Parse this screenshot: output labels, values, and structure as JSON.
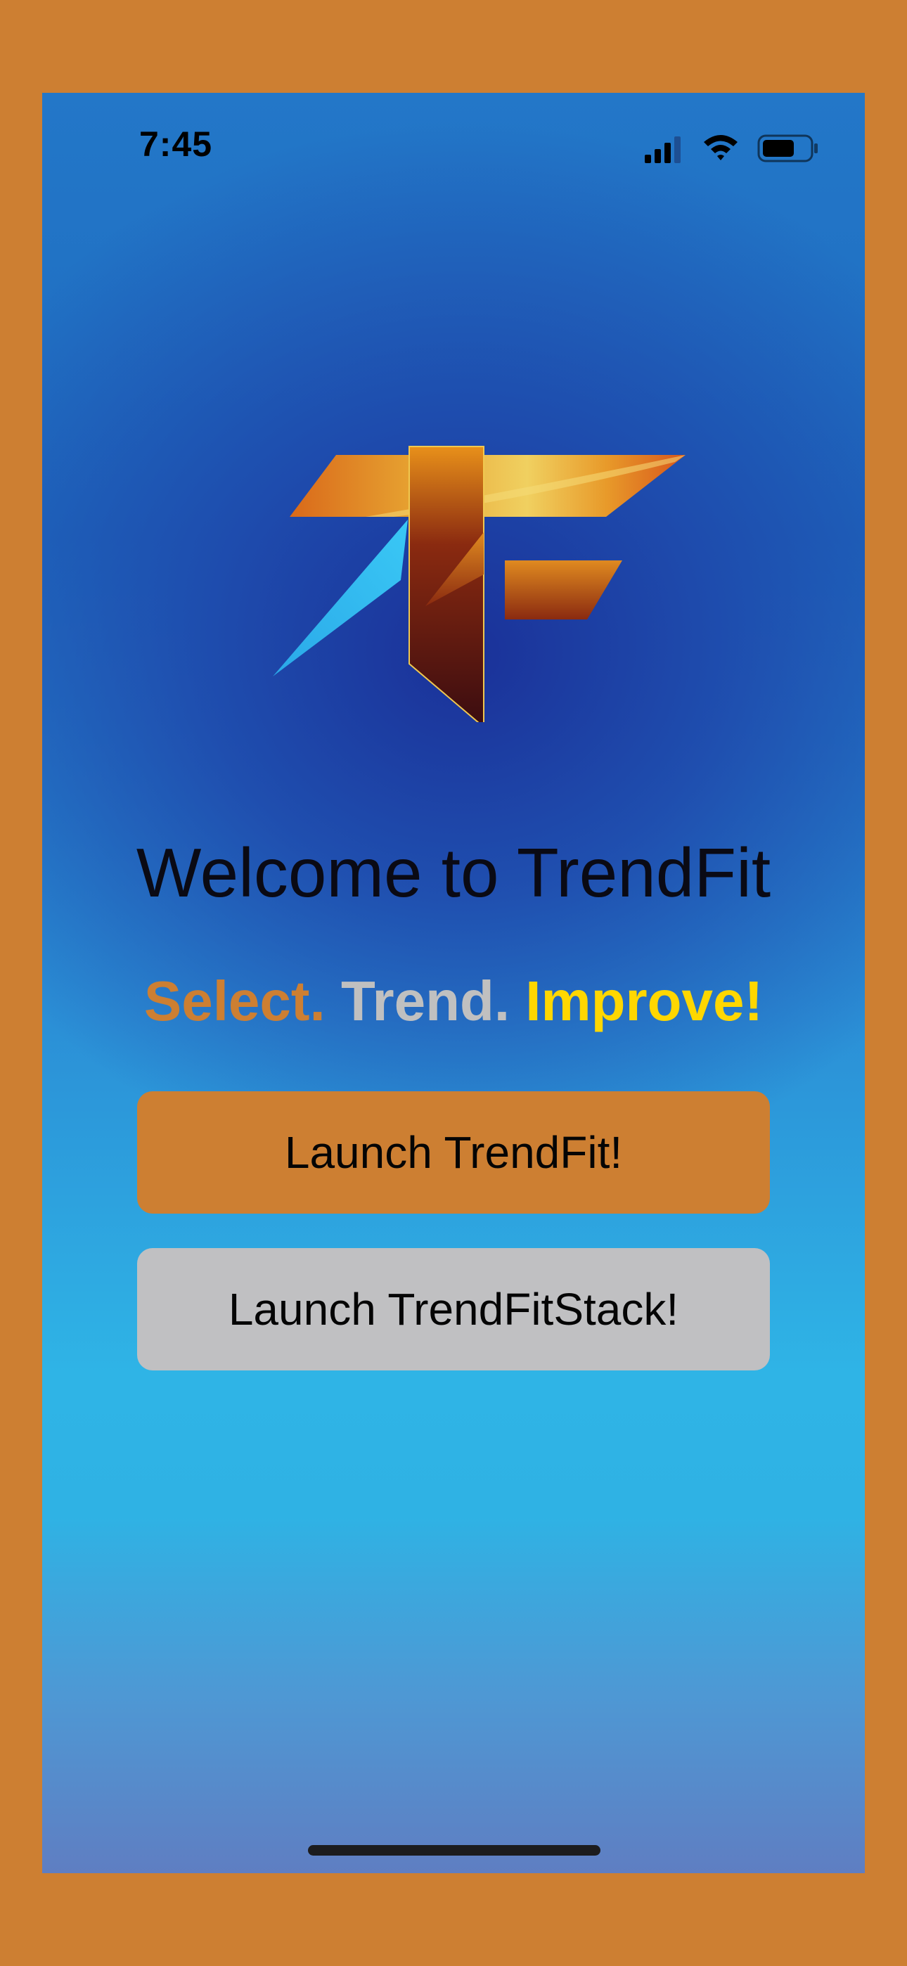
{
  "status_bar": {
    "time": "7:45",
    "icons": [
      "cellular-signal-icon",
      "wifi-icon",
      "battery-icon"
    ]
  },
  "logo": {
    "name": "trendfit-logo",
    "letters": "TF"
  },
  "welcome": {
    "title": "Welcome to TrendFit"
  },
  "tagline": {
    "select": "Select.",
    "trend": "Trend.",
    "improve": "Improve!"
  },
  "buttons": {
    "launch_trendfit": "Launch TrendFit!",
    "launch_trendfitstack": "Launch TrendFitStack!"
  },
  "colors": {
    "frame": "#cd7f32",
    "bronze": "#cd7f32",
    "silver": "#c0c0c0",
    "gold": "#ffd700",
    "screen_top": "#2377c8",
    "screen_bottom": "#5f7ec2"
  }
}
